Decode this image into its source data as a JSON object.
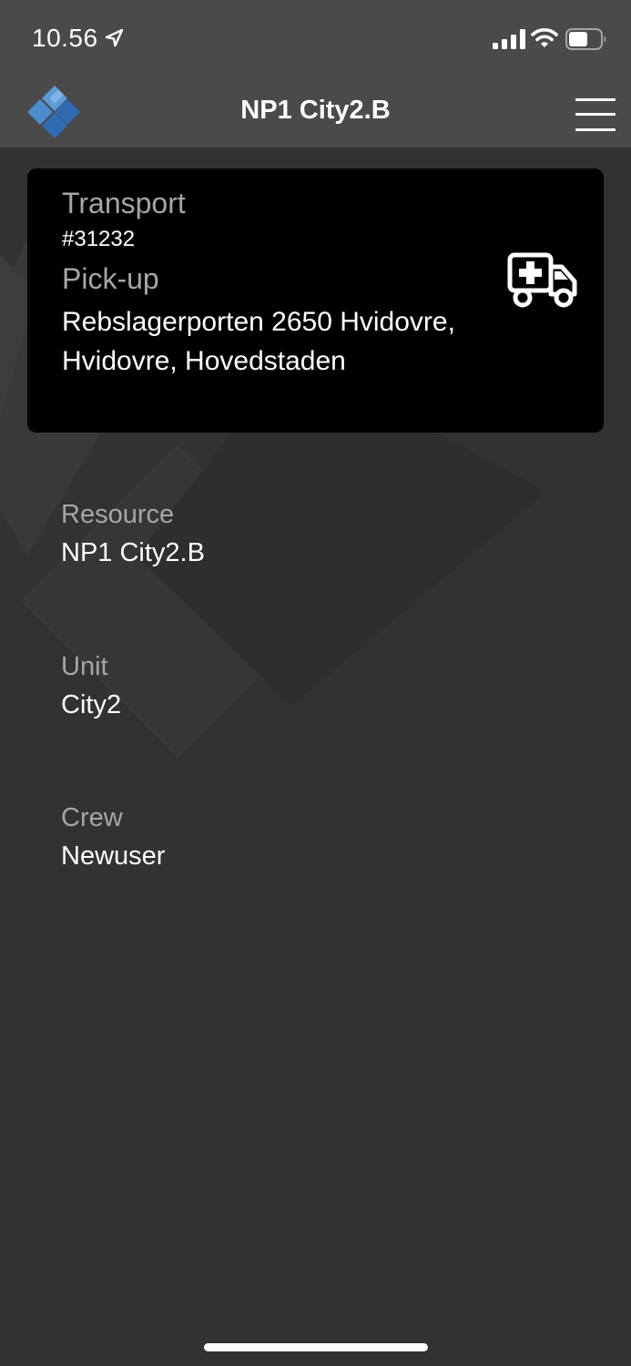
{
  "status_bar": {
    "time": "10.56",
    "icons": [
      "location-arrow-icon",
      "signal-icon",
      "wifi-icon",
      "battery-icon"
    ]
  },
  "nav": {
    "title": "NP1 City2.B",
    "logo_icon": "app-logo-icon",
    "menu_icon": "hamburger-menu-icon"
  },
  "transport_card": {
    "transport_label": "Transport",
    "transport_id": "#31232",
    "pickup_label": "Pick-up",
    "pickup_address": "Rebslagerporten 2650 Hvidovre, Hvidovre, Hovedstaden",
    "icon": "ambulance-icon"
  },
  "details": {
    "resource_label": "Resource",
    "resource_value": "NP1 City2.B",
    "unit_label": "Unit",
    "unit_value": "City2",
    "crew_label": "Crew",
    "crew_value": "Newuser"
  },
  "colors": {
    "background": "#323232",
    "header": "#4a4a4a",
    "card": "#000000",
    "label": "#a6a6a6",
    "text": "#ffffff",
    "logo_light": "#5b9bd5",
    "logo_dark": "#2e6db4"
  }
}
